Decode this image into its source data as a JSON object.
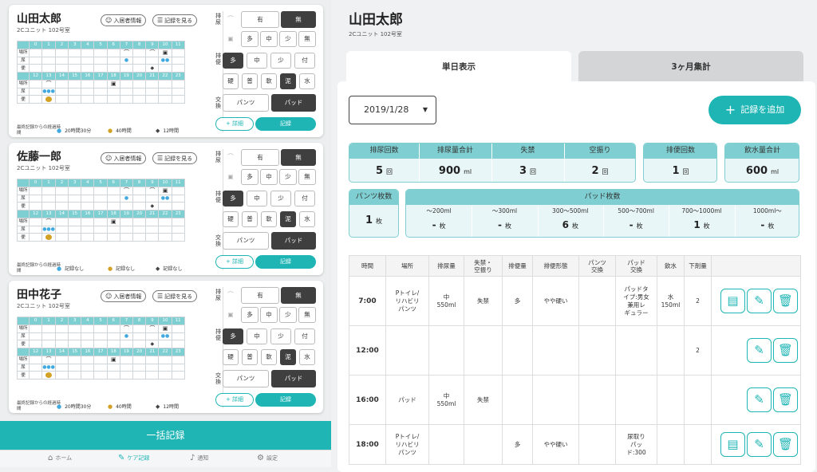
{
  "grid": {
    "row_labels": [
      "場所",
      "尿",
      "便"
    ],
    "hours_am": [
      "0",
      "1",
      "2",
      "3",
      "4",
      "5",
      "6",
      "7",
      "8",
      "9",
      "10",
      "11"
    ],
    "hours_pm": [
      "12",
      "13",
      "14",
      "15",
      "16",
      "17",
      "18",
      "19",
      "20",
      "21",
      "22",
      "23"
    ]
  },
  "buttons": {
    "info": "入居者情報",
    "view": "記録を見る",
    "detail": "+ 詳細",
    "record": "記録"
  },
  "labels": {
    "urine": "排尿",
    "stool": "排便",
    "exchange": "交換",
    "last_record": "最終記録からの経過時間"
  },
  "options": {
    "yes": "有",
    "no": "無",
    "many": "多",
    "medium": "中",
    "few": "少",
    "stain": "付",
    "hard": "硬",
    "normal": "普",
    "soft": "軟",
    "muddy": "泥",
    "water": "水",
    "pants": "パンツ",
    "pad": "パッド"
  },
  "residents": [
    {
      "name": "山田太郎",
      "room": "2Cユニット 102号室",
      "stats": [
        "20時間30分",
        "40時間",
        "12時間"
      ]
    },
    {
      "name": "佐藤一郎",
      "room": "2Cユニット 102号室",
      "stats": [
        "記録なし",
        "記録なし",
        "記録なし"
      ]
    },
    {
      "name": "田中花子",
      "room": "2Cユニット 102号室",
      "stats": [
        "20時間30分",
        "40時間",
        "12時間"
      ]
    }
  ],
  "bulk_record": "一括記録",
  "tabbar": [
    {
      "label": "ホーム",
      "icon": "home-icon"
    },
    {
      "label": "ケア記録",
      "icon": "pencil-icon"
    },
    {
      "label": "通知",
      "icon": "bell-icon"
    },
    {
      "label": "設定",
      "icon": "gear-icon"
    }
  ],
  "detail": {
    "name": "山田太郎",
    "room": "2Cユニット 102号室",
    "tabs": [
      "単日表示",
      "3ヶ月集計"
    ],
    "date": "2019/1/28",
    "add_record": "記録を追加",
    "summary": [
      {
        "label": "排尿回数",
        "value": "5",
        "unit": "回"
      },
      {
        "label": "排尿量合計",
        "value": "900",
        "unit": "ml"
      },
      {
        "label": "失禁",
        "value": "3",
        "unit": "回"
      },
      {
        "label": "空振り",
        "value": "2",
        "unit": "回"
      },
      {
        "label": "排便回数",
        "value": "1",
        "unit": "回"
      },
      {
        "label": "飲水量合計",
        "value": "600",
        "unit": "ml"
      }
    ],
    "pants": {
      "label": "パンツ枚数",
      "value": "1",
      "unit": "枚"
    },
    "pads": {
      "label": "パッド枚数",
      "unit": "枚",
      "items": [
        {
          "label": "〜200ml",
          "value": "-"
        },
        {
          "label": "〜300ml",
          "value": "-"
        },
        {
          "label": "300〜500ml",
          "value": "6"
        },
        {
          "label": "500〜700ml",
          "value": "-"
        },
        {
          "label": "700〜1000ml",
          "value": "1"
        },
        {
          "label": "1000ml〜",
          "value": "-"
        }
      ]
    },
    "columns": [
      "時間",
      "場所",
      "排尿量",
      "失禁・\n空振り",
      "排便量",
      "排便形態",
      "パンツ\n交換",
      "パッド\n交換",
      "飲水",
      "下剤量"
    ],
    "rows": [
      {
        "time": "7:00",
        "place": "Pトイレ/\nリハビリ\nパンツ",
        "urine": "中\n550ml",
        "incont": "失禁",
        "stool": "多",
        "form": "やや硬い",
        "pants": "",
        "pad": "パッドタ\nイプ:男女\n兼用レ\nギュラー",
        "water": "水\n150ml",
        "laxative": "2",
        "memo": true
      },
      {
        "time": "12:00",
        "place": "",
        "urine": "",
        "incont": "",
        "stool": "",
        "form": "",
        "pants": "",
        "pad": "",
        "water": "",
        "laxative": "2",
        "memo": false
      },
      {
        "time": "16:00",
        "place": "パッド",
        "urine": "中\n550ml",
        "incont": "失禁",
        "stool": "",
        "form": "",
        "pants": "",
        "pad": "",
        "water": "",
        "laxative": "",
        "memo": false
      },
      {
        "time": "18:00",
        "place": "Pトイレ/\nリハビリ\nパンツ",
        "urine": "",
        "incont": "",
        "stool": "多",
        "form": "やや硬い",
        "pants": "",
        "pad": "尿取り\nパッ\nド:300",
        "water": "",
        "laxative": "",
        "memo": true
      }
    ]
  },
  "colors": {
    "accent": "#1fb5b5",
    "header_teal": "#7fcfd2",
    "dark_selected": "#3f3f3f"
  }
}
